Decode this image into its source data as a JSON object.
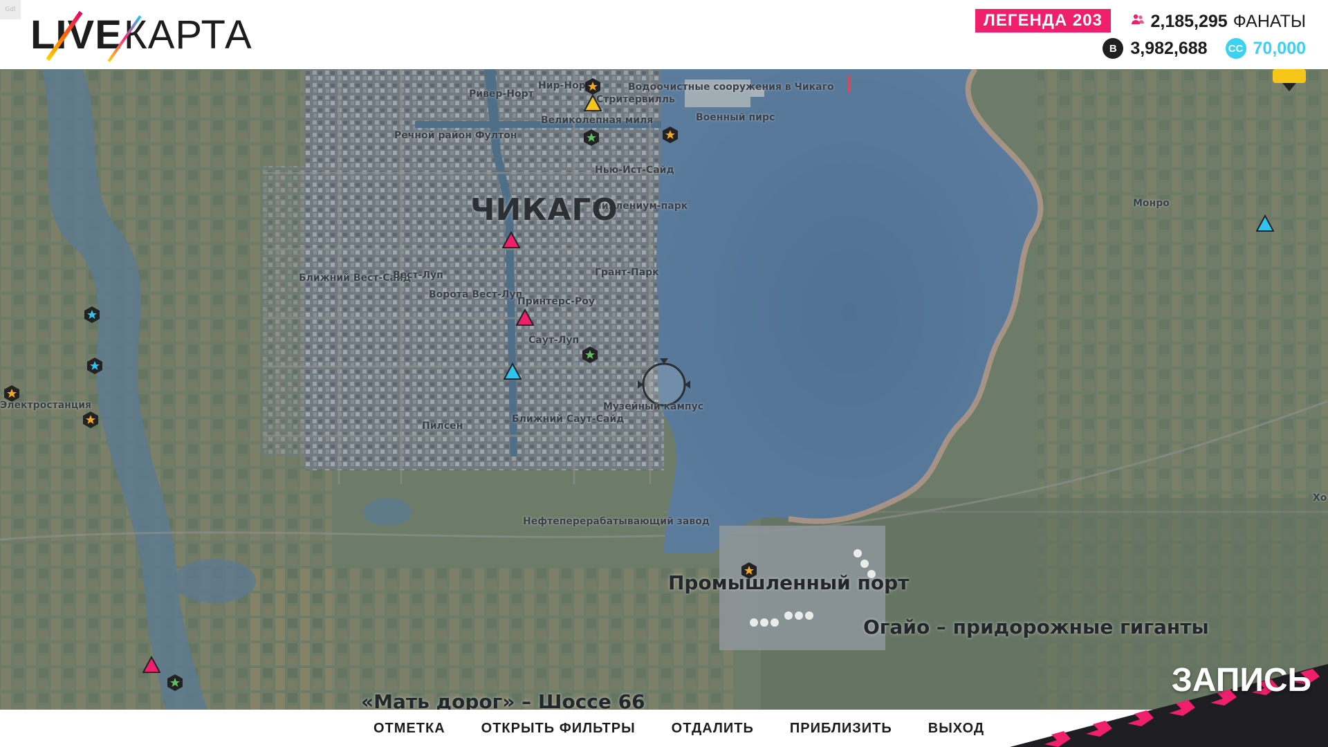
{
  "header": {
    "fps_badge": "Gdl",
    "logo_live": "LIVE",
    "logo_map": "КАРТА",
    "legend_badge": "ЛЕГЕНДА 203",
    "fans_value": "2,185,295",
    "fans_label": "ФАНАТЫ",
    "credits_value": "3,982,688",
    "crew_credits_value": "70,000",
    "credits_icon_glyph": "B",
    "crew_credits_icon_glyph": "CC",
    "colors": {
      "accent_pink": "#ef1f6c",
      "accent_cyan": "#3ad2f0"
    }
  },
  "map": {
    "city_label": "ЧИКАГО",
    "region_labels": [
      "Промышленный порт",
      "Огайо – придорожные гиганты",
      "«Мать дорог» – Шоссе 66"
    ],
    "district_labels": [
      "Ривер-Норт",
      "Нир-Норт",
      "Водоочистные сооружения в Чикаго",
      "Стритервилль",
      "Великолепная миля",
      "Военный пирс",
      "Речной район Фултон",
      "Нью-Ист-Сайд",
      "Миллениум-парк",
      "Монро",
      "Ближний Вест-Сайд",
      "Вест-Луп",
      "Грант-Парк",
      "Ворота Вест-Луп",
      "Принтерс-Роу",
      "Саут-Луп",
      "Электростанция",
      "Музейный кампус",
      "Ближний Саут-Сайд",
      "Пилсен",
      "Нефтеперерабатывающий завод",
      "Хо"
    ],
    "marker_icons": [
      "star-activity-icon",
      "race-event-icon",
      "skill-event-icon",
      "player-cursor-icon"
    ]
  },
  "footer": {
    "buttons": [
      "ОТМЕТКА",
      "ОТКРЫТЬ ФИЛЬТРЫ",
      "ОТДАЛИТЬ",
      "ПРИБЛИЗИТЬ",
      "ВЫХОД"
    ],
    "record_label": "ЗАПИСЬ"
  }
}
